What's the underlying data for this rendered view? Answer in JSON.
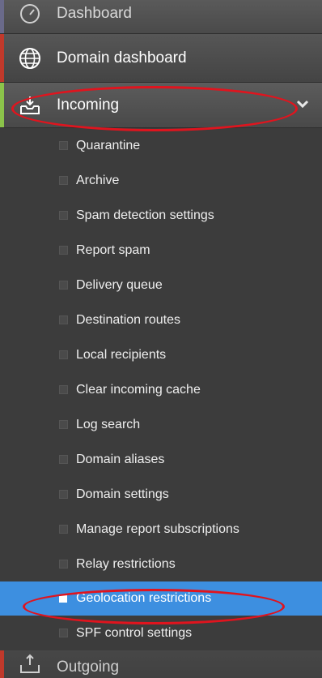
{
  "nav": {
    "dashboard": "Dashboard",
    "domain_dashboard": "Domain dashboard",
    "incoming": "Incoming",
    "outgoing": "Outgoing"
  },
  "incoming_items": [
    "Quarantine",
    "Archive",
    "Spam detection settings",
    "Report spam",
    "Delivery queue",
    "Destination routes",
    "Local recipients",
    "Clear incoming cache",
    "Log search",
    "Domain aliases",
    "Domain settings",
    "Manage report subscriptions",
    "Relay restrictions",
    "Geolocation restrictions",
    "SPF control settings"
  ],
  "active_item": "Geolocation restrictions",
  "colors": {
    "sidebar_bg": "#3c3c3c",
    "active_bg": "#3d8fe0",
    "highlight_ring": "#e0141e",
    "edge_dashboard": "#6a6a8a",
    "edge_domain": "#c0392b",
    "edge_incoming": "#8bc34a",
    "edge_outgoing": "#c0392b"
  },
  "icons": {
    "dashboard": "speedometer-icon",
    "domain_dashboard": "globe-icon",
    "incoming": "inbox-download-icon",
    "outgoing": "inbox-upload-icon",
    "expand": "chevron-down-icon"
  }
}
